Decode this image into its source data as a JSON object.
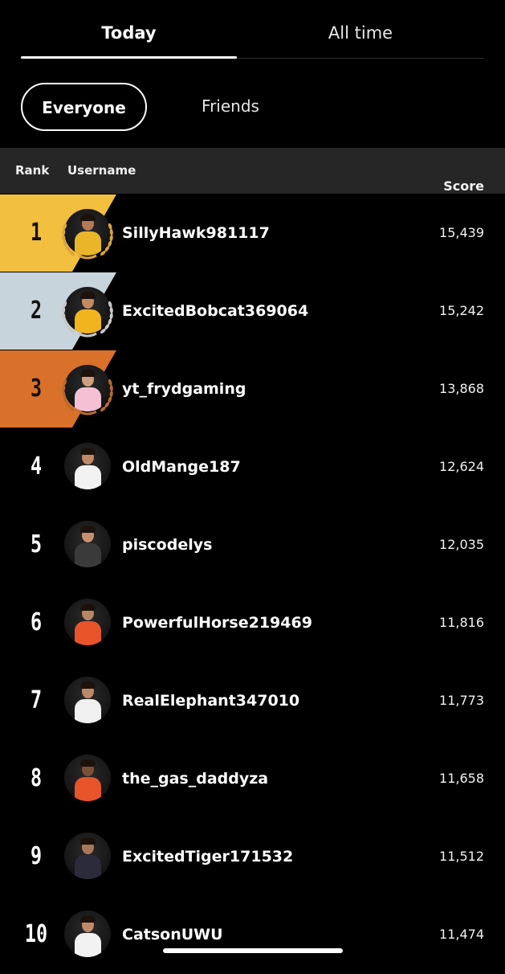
{
  "tabs": {
    "today": "Today",
    "all_time": "All time"
  },
  "filters": {
    "everyone": "Everyone",
    "friends": "Friends"
  },
  "table": {
    "headers": {
      "rank": "Rank",
      "username": "Username",
      "score": "Score"
    },
    "rows": [
      {
        "rank": "1",
        "username": "SillyHawk981117",
        "score": "15,439",
        "band": "#f2bf3f",
        "rank_color": "#111111",
        "wreath": "#d9a53b",
        "skin": "#b47a55",
        "outfit": "#e9b62a"
      },
      {
        "rank": "2",
        "username": "ExcitedBobcat369064",
        "score": "15,242",
        "band": "#c8d4dc",
        "rank_color": "#111111",
        "wreath": "#c8c8c8",
        "skin": "#c68a62",
        "outfit": "#f0b41e"
      },
      {
        "rank": "3",
        "username": "yt_frydgaming",
        "score": "13,868",
        "band": "#d9712a",
        "rank_color": "#111111",
        "wreath": "#b96a2a",
        "skin": "#cfa07e",
        "outfit": "#f3c0d4"
      },
      {
        "rank": "4",
        "username": "OldMange187",
        "score": "12,624",
        "band": "",
        "rank_color": "#ffffff",
        "wreath": "",
        "skin": "#c08a68",
        "outfit": "#f2f2f2"
      },
      {
        "rank": "5",
        "username": "piscodelys",
        "score": "12,035",
        "band": "",
        "rank_color": "#ffffff",
        "wreath": "",
        "skin": "#c59070",
        "outfit": "#3a3a3a"
      },
      {
        "rank": "6",
        "username": "PowerfulHorse219469",
        "score": "11,816",
        "band": "",
        "rank_color": "#ffffff",
        "wreath": "",
        "skin": "#b98666",
        "outfit": "#e8542a"
      },
      {
        "rank": "7",
        "username": "RealElephant347010",
        "score": "11,773",
        "band": "",
        "rank_color": "#ffffff",
        "wreath": "",
        "skin": "#bd8868",
        "outfit": "#f0f0f0"
      },
      {
        "rank": "8",
        "username": "the_gas_daddyza",
        "score": "11,658",
        "band": "",
        "rank_color": "#ffffff",
        "wreath": "",
        "skin": "#7a5036",
        "outfit": "#e8542a"
      },
      {
        "rank": "9",
        "username": "ExcitedTiger171532",
        "score": "11,512",
        "band": "",
        "rank_color": "#ffffff",
        "wreath": "",
        "skin": "#a8785a",
        "outfit": "#2b2b3a"
      },
      {
        "rank": "10",
        "username": "CatsonUWU",
        "score": "11,474",
        "band": "",
        "rank_color": "#ffffff",
        "wreath": "",
        "skin": "#c08a68",
        "outfit": "#f2f2f2"
      }
    ]
  }
}
